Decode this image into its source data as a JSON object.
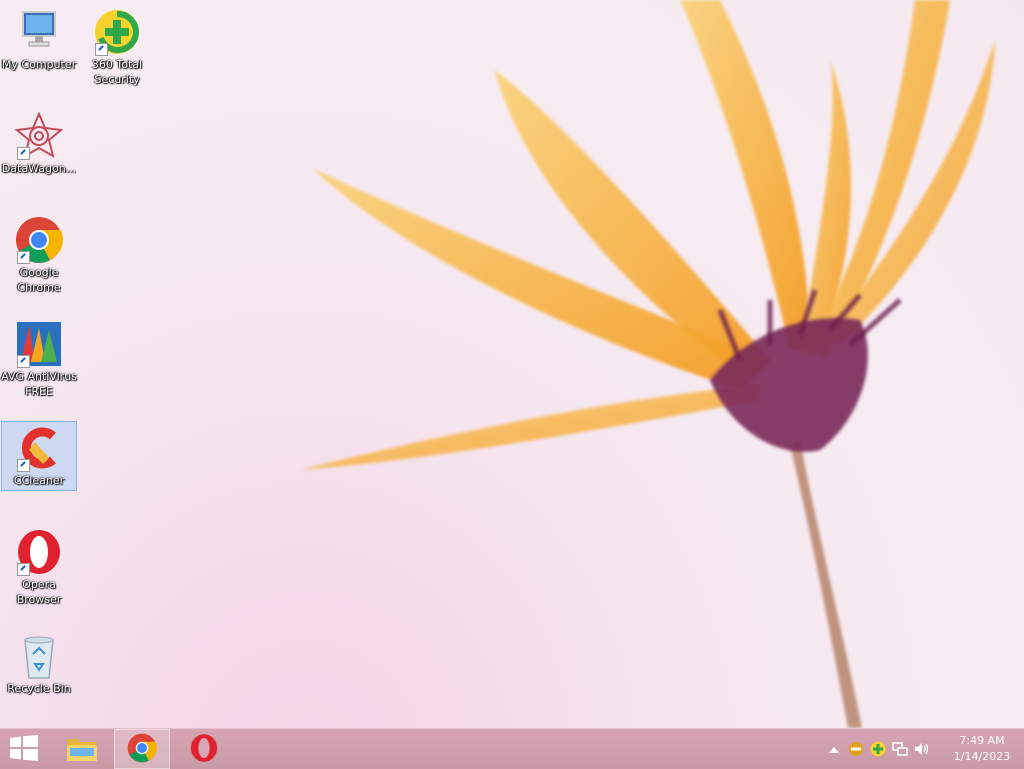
{
  "desktop": {
    "icons": [
      {
        "label": "My Computer",
        "icon": "computer-icon"
      },
      {
        "label": "360 Total Security",
        "icon": "360-security-icon"
      },
      {
        "label": "DataWagon...",
        "icon": "datawagon-icon"
      },
      {
        "label": "Google Chrome",
        "icon": "chrome-icon"
      },
      {
        "label": "AVG AntiVirus FREE",
        "icon": "avg-icon"
      },
      {
        "label": "CCleaner",
        "icon": "ccleaner-icon"
      },
      {
        "label": "Opera Browser",
        "icon": "opera-icon"
      },
      {
        "label": "Recycle Bin",
        "icon": "recycle-bin-icon"
      }
    ],
    "selected_icon": "CCleaner"
  },
  "taskbar": {
    "start_icon": "windows-logo-icon",
    "pinned": [
      {
        "name": "File Explorer",
        "icon": "folder-icon"
      },
      {
        "name": "Google Chrome",
        "icon": "chrome-icon",
        "active": true
      },
      {
        "name": "Opera",
        "icon": "opera-icon"
      }
    ],
    "tray": {
      "icons": [
        "show-hidden-icons-icon",
        "no-entry-icon",
        "360-security-tray-icon",
        "network-icon",
        "volume-icon"
      ]
    },
    "clock": {
      "time": "7:49 AM",
      "date": "1/14/2023"
    }
  },
  "colors": {
    "taskbar": "#c99aa8",
    "selection": "#aacdf0",
    "petal": "#f6b53a",
    "flower_center": "#7a2a5a"
  }
}
